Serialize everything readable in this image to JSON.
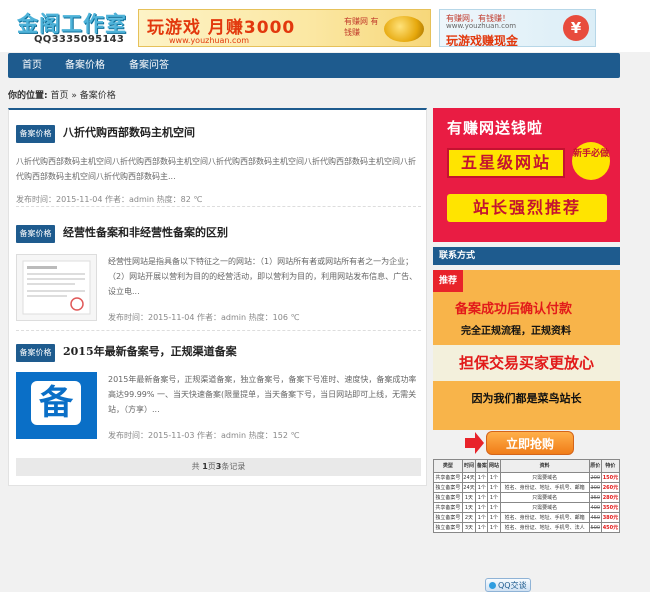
{
  "header": {
    "logo_text": "金阁工作室",
    "qq": "QQ3335095143",
    "banner1": {
      "title": "玩游戏 月赚3000",
      "url": "www.youzhuan.com",
      "side_text": "有赚网 有钱赚"
    },
    "banner2": {
      "line1": "有赚网，有钱赚！",
      "line2": "www.youzhuan.com",
      "line3": "玩游戏赚现金",
      "symbol": "¥"
    }
  },
  "nav": {
    "items": [
      {
        "label": "首页"
      },
      {
        "label": "备案价格"
      },
      {
        "label": "备案问答"
      }
    ]
  },
  "breadcrumb": {
    "label": "你的位置:",
    "home": "首页",
    "sep": "»",
    "current": "备案价格"
  },
  "articles": [
    {
      "badge": "备案价格",
      "title": "八折代购西部数码主机空间",
      "excerpt": "八折代购西部数码主机空间八折代购西部数码主机空间八折代购西部数码主机空间八折代购西部数码主机空间八折代购西部数码主机空间八折代购西部数码主...",
      "meta": "发布时间：2015-11-04 作者：admin 热度：82 ℃"
    },
    {
      "badge": "备案价格",
      "title": "经营性备案和非经营性备案的区别",
      "excerpt": "经营性网站是指具备以下特征之一的网站：（1）网站所有者或网站所有者之一为企业；（2）网站开展以营利为目的的经营活动，即以营利为目的，利用网站发布信息、广告、设立电...",
      "meta": "发布时间：2015-11-04 作者：admin 热度：106 ℃"
    },
    {
      "badge": "备案价格",
      "title": "2015年最新备案号，正规渠道备案",
      "excerpt": "2015年最新备案号，正规渠道备案，独立备案号，备案下号准时、速度快，备案成功率高达99.99% 一、当天快速备案(限量提单，当天备案下号，当日网站即可上线，无需关站，（方享）...",
      "meta": "发布时间：2015-11-03 作者：admin 热度：152 ℃",
      "thumb_glyph": "备"
    }
  ],
  "pager": {
    "pre": "共",
    "pages": "1",
    "mid": "页",
    "count": "3",
    "post": "条记录"
  },
  "sidebar": {
    "ad1": {
      "line1": "有赚网送钱啦",
      "line2": "五星级网站",
      "badge": "新手必做",
      "line3": "站长强烈推荐"
    },
    "contact_title": "联系方式",
    "ad2": {
      "corner": "推荐",
      "line1": "备案成功后确认付款",
      "line2": "完全正规流程，正规资料",
      "line3": "担保交易买家更放心",
      "line4": "因为我们都是菜鸟站长"
    },
    "grab_label": "立即抢购",
    "price_table": {
      "headers": [
        "类型",
        "时间",
        "备案",
        "网站",
        "资料",
        "原价",
        "特价"
      ],
      "rows": [
        [
          "共享备案号",
          "24天",
          "1个",
          "1个",
          "只需要域名",
          "200",
          "150元"
        ],
        [
          "独立备案号",
          "24天",
          "1个",
          "1个",
          "姓名、身份证、地址、手机号、邮箱",
          "300",
          "260元"
        ],
        [
          "独立备案号",
          "1天",
          "1个",
          "1个",
          "只需要域名",
          "350",
          "280元"
        ],
        [
          "共享备案号",
          "1天",
          "1个",
          "1个",
          "只需要域名",
          "400",
          "350元"
        ],
        [
          "独立备案号",
          "2天",
          "1个",
          "1个",
          "姓名、身份证、地址、手机号、邮箱",
          "450",
          "380元"
        ],
        [
          "独立备案号",
          "3天",
          "1个",
          "1个",
          "姓名、身份证、地址、手机号、法人",
          "500",
          "450元"
        ]
      ]
    },
    "qq_button": "QQ交谈"
  },
  "colors": {
    "primary": "#1e5b8e",
    "accent_red": "#e91c43",
    "ad_orange": "#f8b44a"
  }
}
